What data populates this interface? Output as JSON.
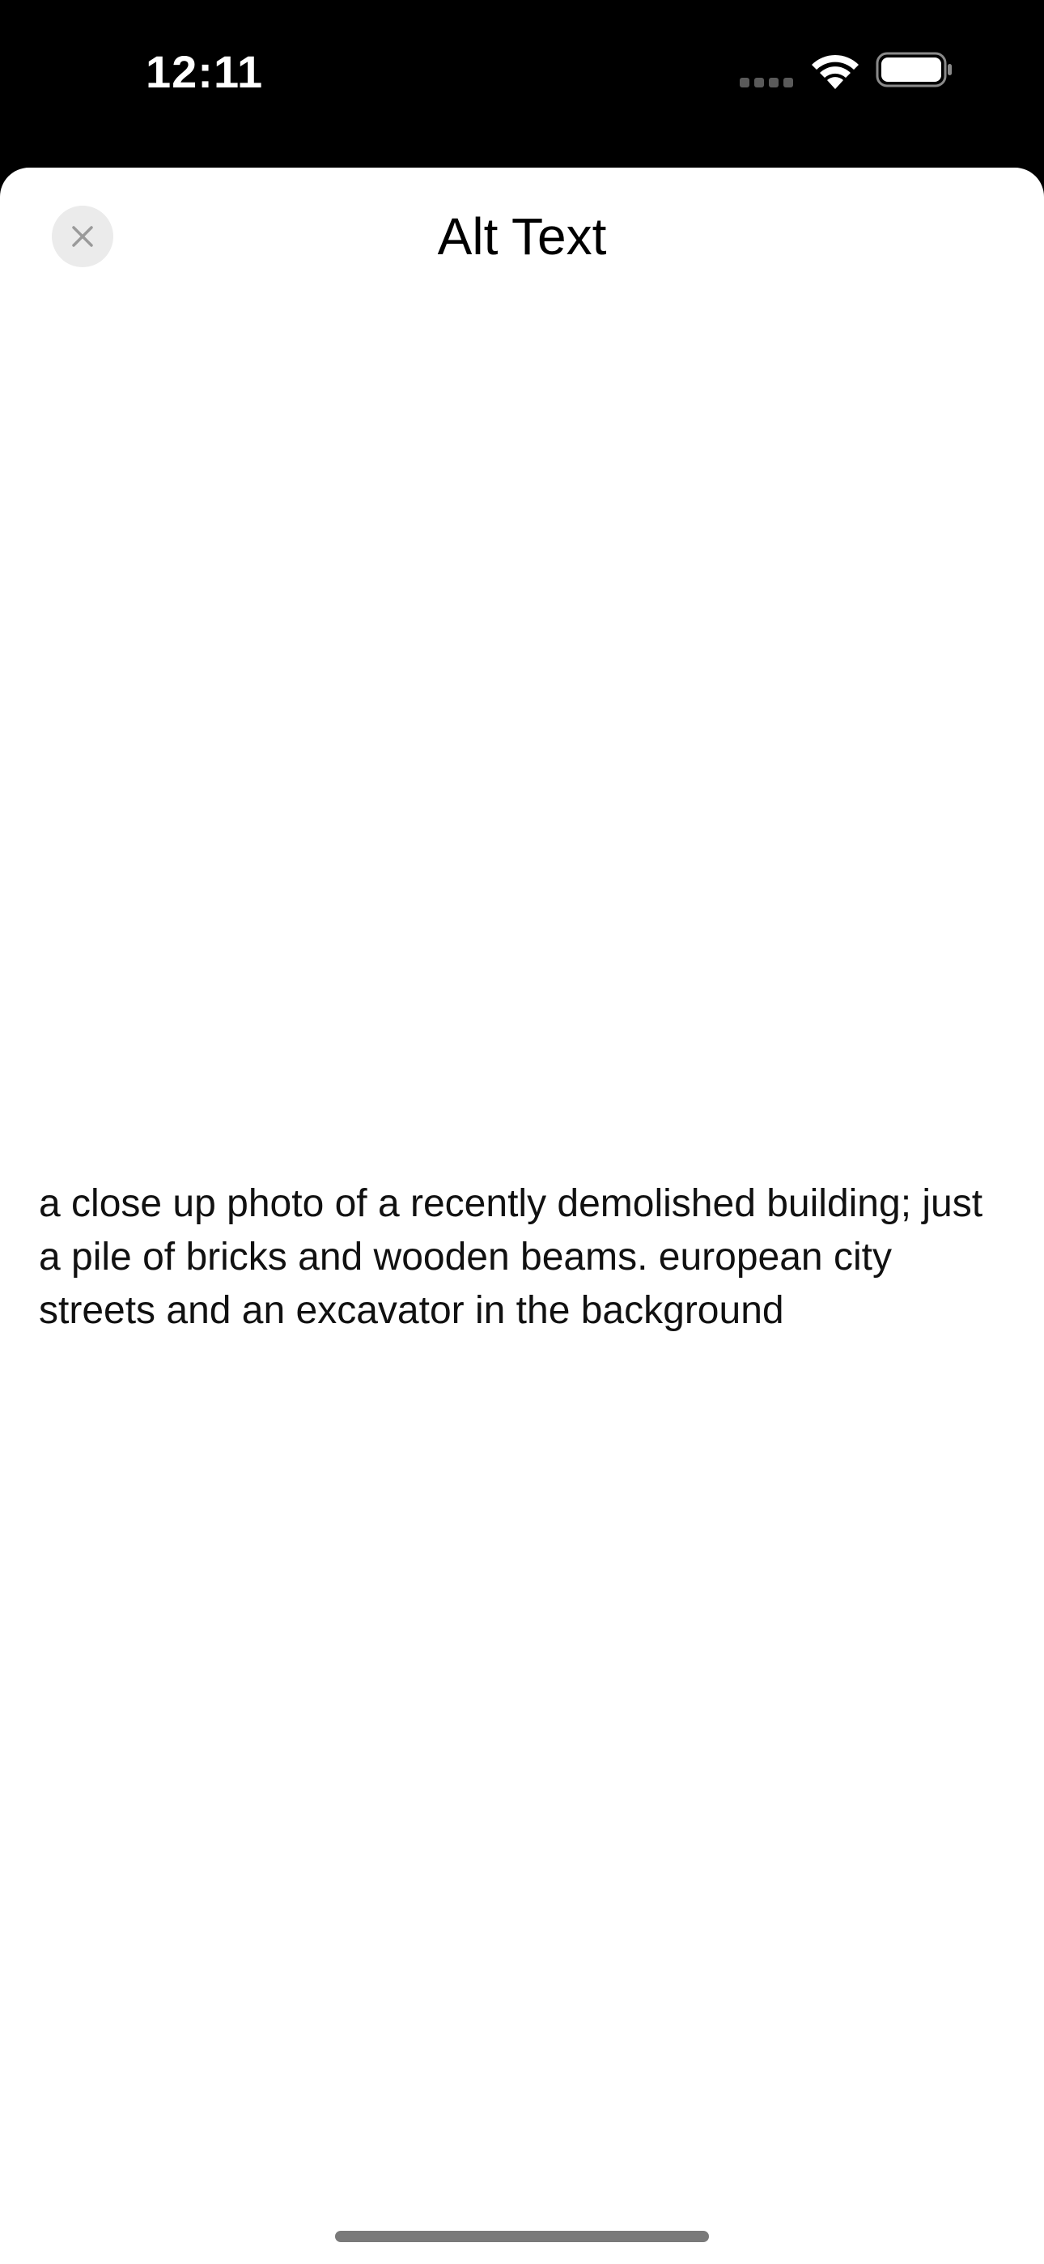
{
  "status_bar": {
    "time": "12:11",
    "icons": [
      "cellular-signal-icon",
      "wifi-icon",
      "battery-icon"
    ]
  },
  "sheet": {
    "title": "Alt Text",
    "close_icon": "close-icon",
    "alt_text": "a close up photo of a recently demolished building; just a pile of bricks and wooden beams. european city streets and an excavator in the background"
  },
  "colors": {
    "status_bar_background": "#000000",
    "sheet_background": "#ffffff",
    "close_button_background": "#ebebeb",
    "text": "#000000"
  }
}
